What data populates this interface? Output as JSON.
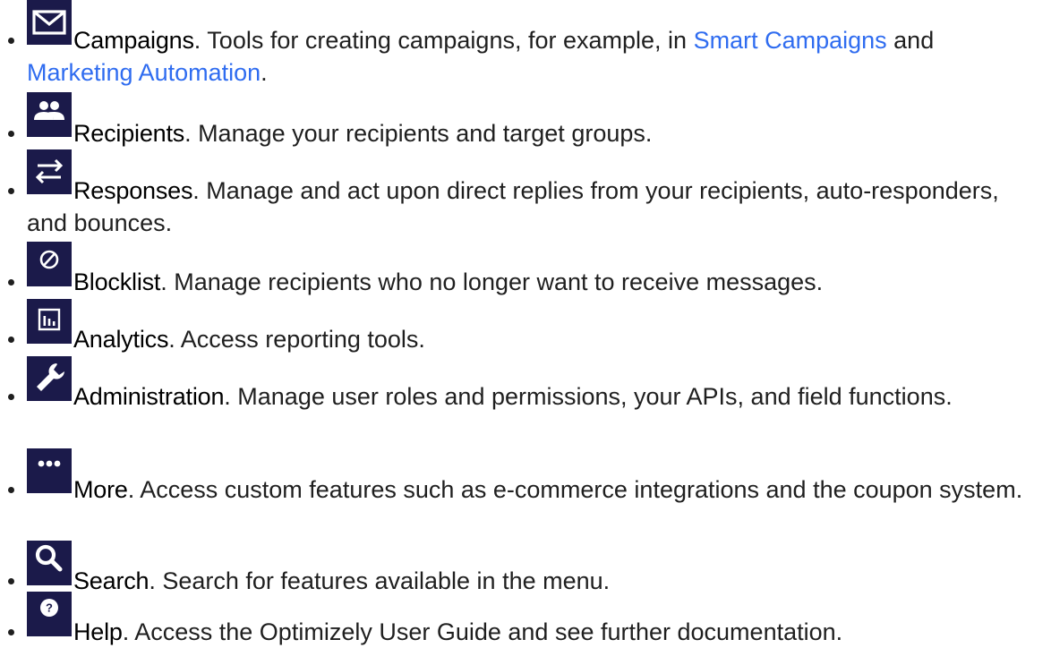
{
  "items": [
    {
      "icon": "envelope-icon",
      "name": "Campaigns",
      "desc_before": ". Tools for creating campaigns, for example, in ",
      "link1": "Smart Campaigns",
      "desc_mid": " and ",
      "link2": "Marketing Automation",
      "desc_after": "."
    },
    {
      "icon": "people-icon",
      "name": "Recipients",
      "desc": ". Manage your recipients and target groups."
    },
    {
      "icon": "swap-arrows-icon",
      "name": "Responses",
      "desc": ". Manage and act upon direct replies from your recipients, auto-responders, and bounces."
    },
    {
      "icon": "block-icon",
      "name": "Blocklist",
      "desc": ". Manage recipients who no longer want to receive messages."
    },
    {
      "icon": "bar-chart-icon",
      "name": "Analytics",
      "desc": ". Access reporting tools."
    },
    {
      "icon": "wrench-icon",
      "name": "Administration",
      "desc": ". Manage user roles and permissions, your APIs, and field functions."
    },
    {
      "icon": "more-dots-icon",
      "name": "More",
      "desc": ". Access custom features such as e-commerce integrations and the coupon system."
    },
    {
      "icon": "search-icon",
      "name": "Search",
      "desc": ". Search for features available in the menu."
    },
    {
      "icon": "help-icon",
      "name": "Help",
      "desc": ". Access the Optimizely User Guide and see further documentation."
    }
  ],
  "colors": {
    "icon_bg": "#1b1a4a",
    "icon_fg": "#ffffff",
    "link": "#2f6cf0",
    "text": "#1f1f1f"
  }
}
